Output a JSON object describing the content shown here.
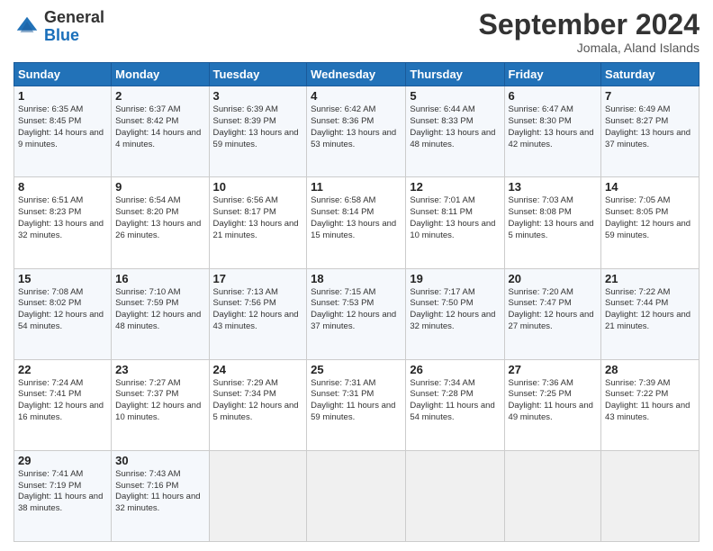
{
  "header": {
    "logo_general": "General",
    "logo_blue": "Blue",
    "month_title": "September 2024",
    "location": "Jomala, Aland Islands"
  },
  "days_of_week": [
    "Sunday",
    "Monday",
    "Tuesday",
    "Wednesday",
    "Thursday",
    "Friday",
    "Saturday"
  ],
  "weeks": [
    [
      {
        "day": "1",
        "sunrise": "6:35 AM",
        "sunset": "8:45 PM",
        "daylight": "14 hours and 9 minutes."
      },
      {
        "day": "2",
        "sunrise": "6:37 AM",
        "sunset": "8:42 PM",
        "daylight": "14 hours and 4 minutes."
      },
      {
        "day": "3",
        "sunrise": "6:39 AM",
        "sunset": "8:39 PM",
        "daylight": "13 hours and 59 minutes."
      },
      {
        "day": "4",
        "sunrise": "6:42 AM",
        "sunset": "8:36 PM",
        "daylight": "13 hours and 53 minutes."
      },
      {
        "day": "5",
        "sunrise": "6:44 AM",
        "sunset": "8:33 PM",
        "daylight": "13 hours and 48 minutes."
      },
      {
        "day": "6",
        "sunrise": "6:47 AM",
        "sunset": "8:30 PM",
        "daylight": "13 hours and 42 minutes."
      },
      {
        "day": "7",
        "sunrise": "6:49 AM",
        "sunset": "8:27 PM",
        "daylight": "13 hours and 37 minutes."
      }
    ],
    [
      {
        "day": "8",
        "sunrise": "6:51 AM",
        "sunset": "8:23 PM",
        "daylight": "13 hours and 32 minutes."
      },
      {
        "day": "9",
        "sunrise": "6:54 AM",
        "sunset": "8:20 PM",
        "daylight": "13 hours and 26 minutes."
      },
      {
        "day": "10",
        "sunrise": "6:56 AM",
        "sunset": "8:17 PM",
        "daylight": "13 hours and 21 minutes."
      },
      {
        "day": "11",
        "sunrise": "6:58 AM",
        "sunset": "8:14 PM",
        "daylight": "13 hours and 15 minutes."
      },
      {
        "day": "12",
        "sunrise": "7:01 AM",
        "sunset": "8:11 PM",
        "daylight": "13 hours and 10 minutes."
      },
      {
        "day": "13",
        "sunrise": "7:03 AM",
        "sunset": "8:08 PM",
        "daylight": "13 hours and 5 minutes."
      },
      {
        "day": "14",
        "sunrise": "7:05 AM",
        "sunset": "8:05 PM",
        "daylight": "12 hours and 59 minutes."
      }
    ],
    [
      {
        "day": "15",
        "sunrise": "7:08 AM",
        "sunset": "8:02 PM",
        "daylight": "12 hours and 54 minutes."
      },
      {
        "day": "16",
        "sunrise": "7:10 AM",
        "sunset": "7:59 PM",
        "daylight": "12 hours and 48 minutes."
      },
      {
        "day": "17",
        "sunrise": "7:13 AM",
        "sunset": "7:56 PM",
        "daylight": "12 hours and 43 minutes."
      },
      {
        "day": "18",
        "sunrise": "7:15 AM",
        "sunset": "7:53 PM",
        "daylight": "12 hours and 37 minutes."
      },
      {
        "day": "19",
        "sunrise": "7:17 AM",
        "sunset": "7:50 PM",
        "daylight": "12 hours and 32 minutes."
      },
      {
        "day": "20",
        "sunrise": "7:20 AM",
        "sunset": "7:47 PM",
        "daylight": "12 hours and 27 minutes."
      },
      {
        "day": "21",
        "sunrise": "7:22 AM",
        "sunset": "7:44 PM",
        "daylight": "12 hours and 21 minutes."
      }
    ],
    [
      {
        "day": "22",
        "sunrise": "7:24 AM",
        "sunset": "7:41 PM",
        "daylight": "12 hours and 16 minutes."
      },
      {
        "day": "23",
        "sunrise": "7:27 AM",
        "sunset": "7:37 PM",
        "daylight": "12 hours and 10 minutes."
      },
      {
        "day": "24",
        "sunrise": "7:29 AM",
        "sunset": "7:34 PM",
        "daylight": "12 hours and 5 minutes."
      },
      {
        "day": "25",
        "sunrise": "7:31 AM",
        "sunset": "7:31 PM",
        "daylight": "11 hours and 59 minutes."
      },
      {
        "day": "26",
        "sunrise": "7:34 AM",
        "sunset": "7:28 PM",
        "daylight": "11 hours and 54 minutes."
      },
      {
        "day": "27",
        "sunrise": "7:36 AM",
        "sunset": "7:25 PM",
        "daylight": "11 hours and 49 minutes."
      },
      {
        "day": "28",
        "sunrise": "7:39 AM",
        "sunset": "7:22 PM",
        "daylight": "11 hours and 43 minutes."
      }
    ],
    [
      {
        "day": "29",
        "sunrise": "7:41 AM",
        "sunset": "7:19 PM",
        "daylight": "11 hours and 38 minutes."
      },
      {
        "day": "30",
        "sunrise": "7:43 AM",
        "sunset": "7:16 PM",
        "daylight": "11 hours and 32 minutes."
      },
      null,
      null,
      null,
      null,
      null
    ]
  ]
}
